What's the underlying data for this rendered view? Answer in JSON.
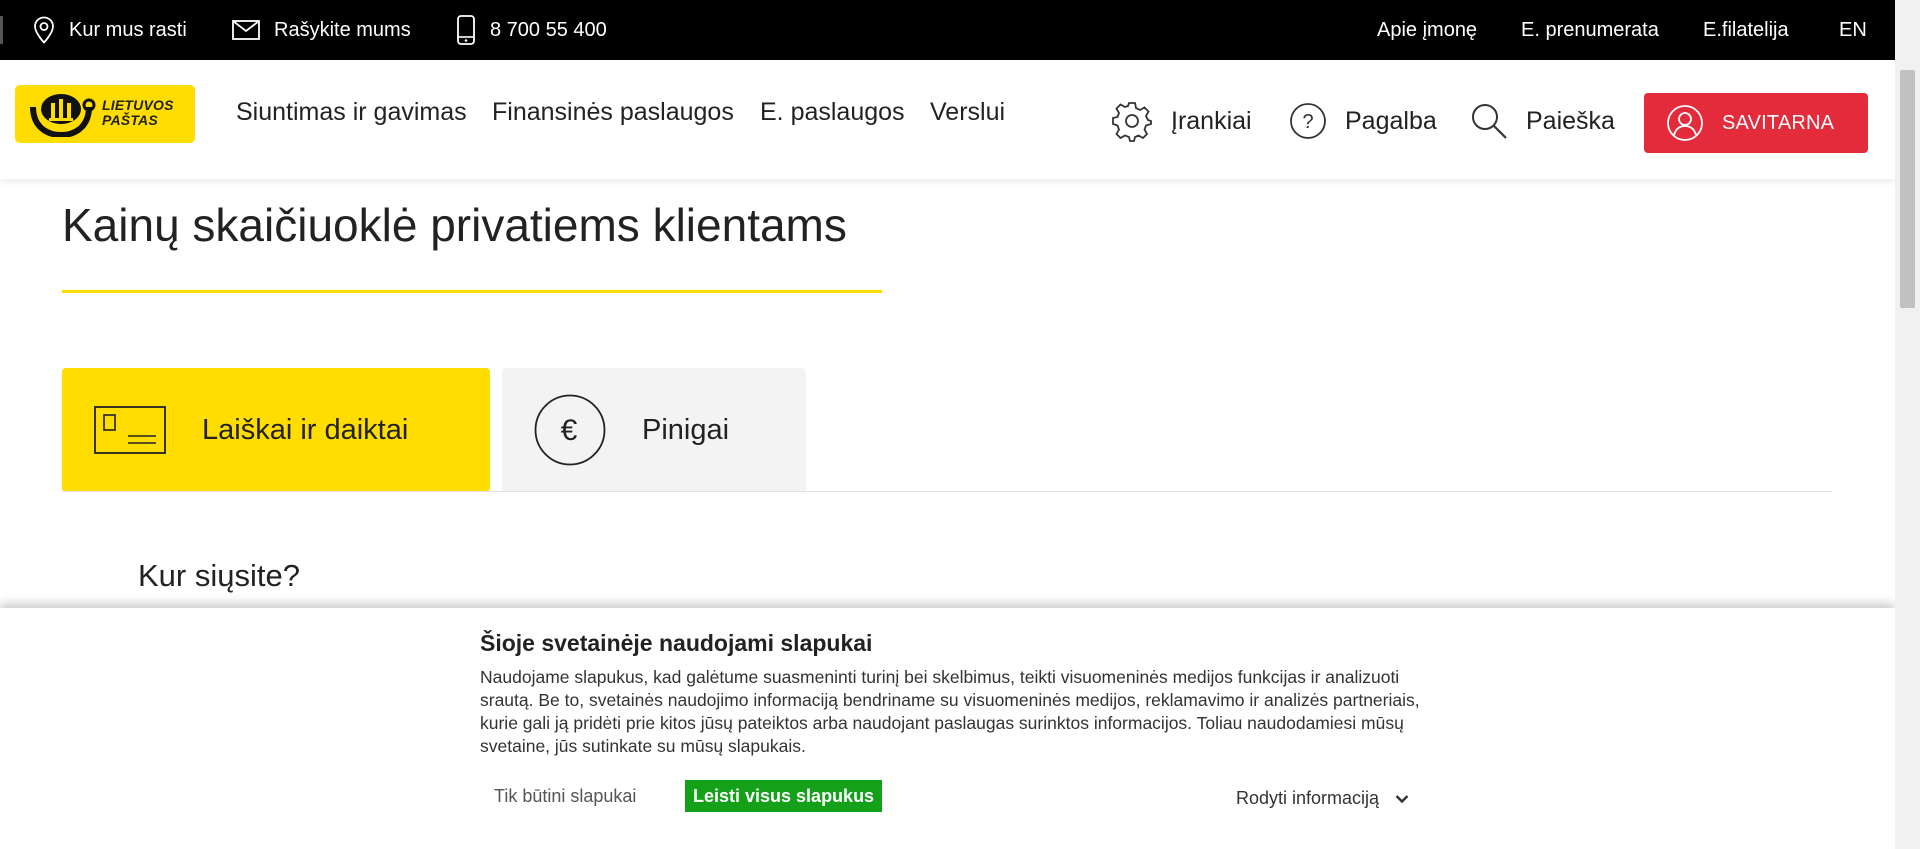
{
  "topbar": {
    "location": "Kur mus rasti",
    "mail": "Rašykite mums",
    "phone": "8 700 55 400",
    "about": "Apie įmonę",
    "subscription": "E. prenumerata",
    "philately": "E.filatelija",
    "language": "EN"
  },
  "header": {
    "logo_line1": "LIETUVOS",
    "logo_line2": "PAŠTAS",
    "nav": [
      "Siuntimas ir gavimas",
      "Finansinės paslaugos",
      "E. paslaugos",
      "Verslui"
    ],
    "tools": "Įrankiai",
    "help": "Pagalba",
    "search": "Paieška",
    "self_service": "SAVITARNA"
  },
  "main": {
    "title": "Kainų skaičiuoklė privatiems klientams",
    "tabs": [
      {
        "label": "Laiškai ir daiktai",
        "icon": "letter-card-icon",
        "active": true
      },
      {
        "label": "Pinigai",
        "icon": "euro-icon",
        "active": false
      }
    ],
    "question": "Kur siųsite?"
  },
  "cookie": {
    "title": "Šioje svetainėje naudojami slapukai",
    "text": "Naudojame slapukus, kad galėtume suasmeninti turinį bei skelbimus, teikti visuomeninės medijos funkcijas ir analizuoti srautą. Be to, svetainės naudojimo informaciją bendriname su visuomeninės medijos, reklamavimo ir analizės partneriais, kurie gali ją pridėti prie kitos jūsų pateiktos arba naudojant paslaugas surinktos informacijos. Toliau naudodamiesi mūsų svetaine, jūs sutinkate su mūsų slapukais.",
    "necessary_button": "Tik būtini slapukai",
    "accept_all_button": "Leisti visus slapukus",
    "show_info": "Rodyti informaciją"
  },
  "colors": {
    "brand_yellow": "#ffdd00",
    "accent_red": "#e32b3c",
    "accept_green": "#15a01a",
    "topbar_black": "#000000"
  }
}
